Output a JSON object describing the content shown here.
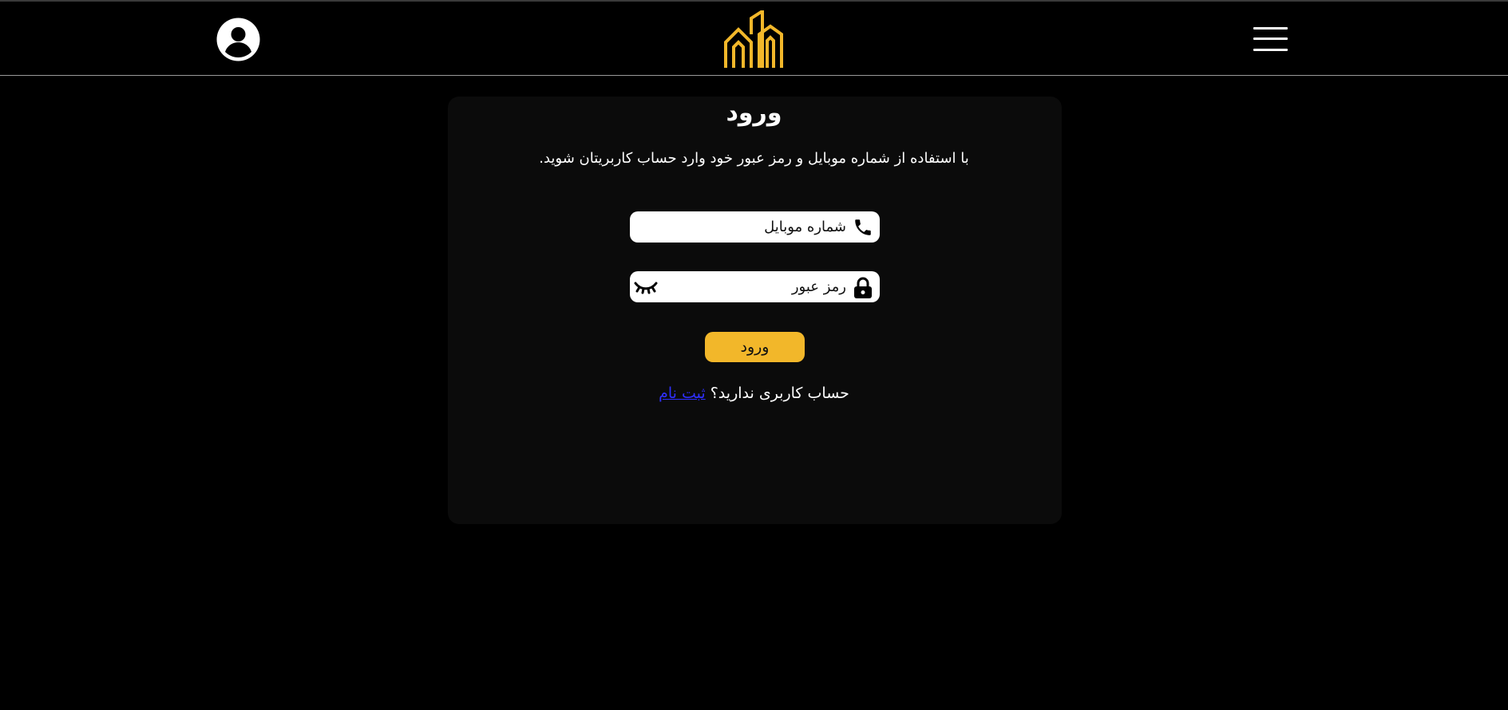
{
  "header": {
    "avatar_icon": "user-avatar-icon",
    "logo_icon": "buildings-logo-icon",
    "menu_icon": "hamburger-menu-icon"
  },
  "login_card": {
    "title": "ورود",
    "subtitle": "با استفاده از شماره موبایل و رمز عبور خود وارد حساب کاربریتان شوید.",
    "phone_field": {
      "placeholder": "شماره موبایل",
      "value": "",
      "icon": "phone-icon"
    },
    "password_field": {
      "placeholder": "رمز عبور",
      "value": "",
      "icon": "lock-icon",
      "toggle_icon": "eye-closed-icon"
    },
    "submit_label": "ورود",
    "signup_prompt": "حساب کاربری ندارید؟",
    "signup_link": "ثبت نام"
  },
  "colors": {
    "background": "#000000",
    "card": "#0b0b0b",
    "accent": "#f2b72a",
    "link": "#2f2fff"
  }
}
